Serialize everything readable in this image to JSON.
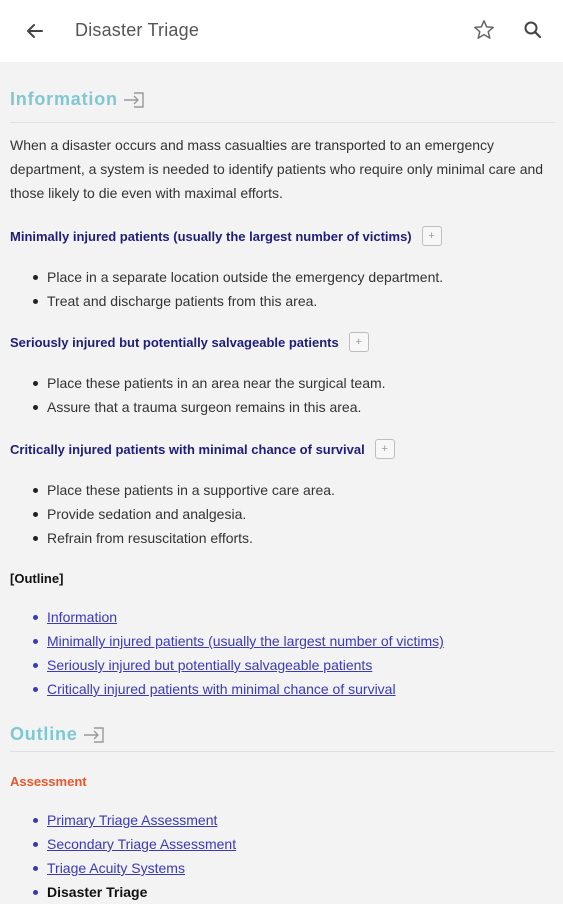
{
  "appbar": {
    "title": "Disaster Triage",
    "back_icon": "arrow-left-icon",
    "star_icon": "star-outline-icon",
    "search_icon": "search-icon"
  },
  "information": {
    "heading": "Information",
    "intro": "When a disaster occurs and mass casualties are transported to an emergency department, a system is needed to identify patients who require only minimal care and those likely to die even with maximal efforts.",
    "groups": [
      {
        "title": "Minimally injured patients (usually the largest number of victims)",
        "items": [
          "Place in a separate location outside the emergency department.",
          "Treat and discharge patients from this area."
        ]
      },
      {
        "title": "Seriously injured but potentially salvageable patients",
        "items": [
          "Place these patients in an area near the surgical team.",
          "Assure that a trauma surgeon remains in this area."
        ]
      },
      {
        "title": "Critically injured patients with minimal chance of survival",
        "items": [
          "Place these patients in a supportive care area.",
          "Provide sedation and analgesia.",
          "Refrain from resuscitation efforts."
        ]
      }
    ],
    "outline_label": "[Outline]",
    "outline_links": [
      "Information",
      "Minimally injured patients (usually the largest number of victims)",
      "Seriously injured but potentially salvageable patients",
      "Critically injured patients with minimal chance of survival"
    ]
  },
  "outline": {
    "heading": "Outline",
    "category": "Assessment",
    "items": [
      {
        "label": "Primary Triage Assessment",
        "current": false
      },
      {
        "label": "Secondary Triage Assessment",
        "current": false
      },
      {
        "label": "Triage Acuity Systems",
        "current": false
      },
      {
        "label": "Disaster Triage",
        "current": true
      }
    ]
  },
  "colors": {
    "section_heading": "#7ec8d1",
    "subheading": "#1d1d7a",
    "link": "#3a39b8",
    "category": "#e8582a"
  }
}
